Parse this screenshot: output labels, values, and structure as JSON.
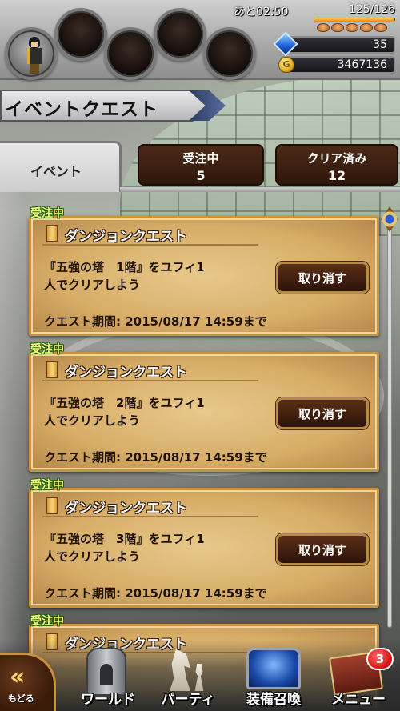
{
  "status_bar": {
    "stamina_label": "あと02:50",
    "stamina_value": "125/126",
    "stamina_fraction": 0.99,
    "gems": "35",
    "gil": "3467136"
  },
  "header": {
    "title": "イベントクエスト"
  },
  "tabs": {
    "event": "イベント",
    "accepted": {
      "label": "受注中",
      "count": "5"
    },
    "cleared": {
      "label": "クリア済み",
      "count": "12"
    }
  },
  "quests": [
    {
      "status": "受注中",
      "type": "ダンジョンクエスト",
      "desc_line1": "『五強の塔　1階』をユフィ1",
      "desc_line2": "人でクリアしよう",
      "button": "取り消す",
      "period": "クエスト期間: 2015/08/17 14:59まで"
    },
    {
      "status": "受注中",
      "type": "ダンジョンクエスト",
      "desc_line1": "『五強の塔　2階』をユフィ1",
      "desc_line2": "人でクリアしよう",
      "button": "取り消す",
      "period": "クエスト期間: 2015/08/17 14:59まで"
    },
    {
      "status": "受注中",
      "type": "ダンジョンクエスト",
      "desc_line1": "『五強の塔　3階』をユフィ1",
      "desc_line2": "人でクリアしよう",
      "button": "取り消す",
      "period": "クエスト期間: 2015/08/17 14:59まで"
    },
    {
      "status": "受注中",
      "type": "ダンジョンクエスト",
      "desc_line1": "",
      "desc_line2": "",
      "button": "",
      "period": ""
    }
  ],
  "bottom_nav": {
    "back": "もどる",
    "world": "ワールド",
    "party": "パーティ",
    "summon": "装備召喚",
    "menu": "メニュー",
    "menu_badge": "3"
  }
}
